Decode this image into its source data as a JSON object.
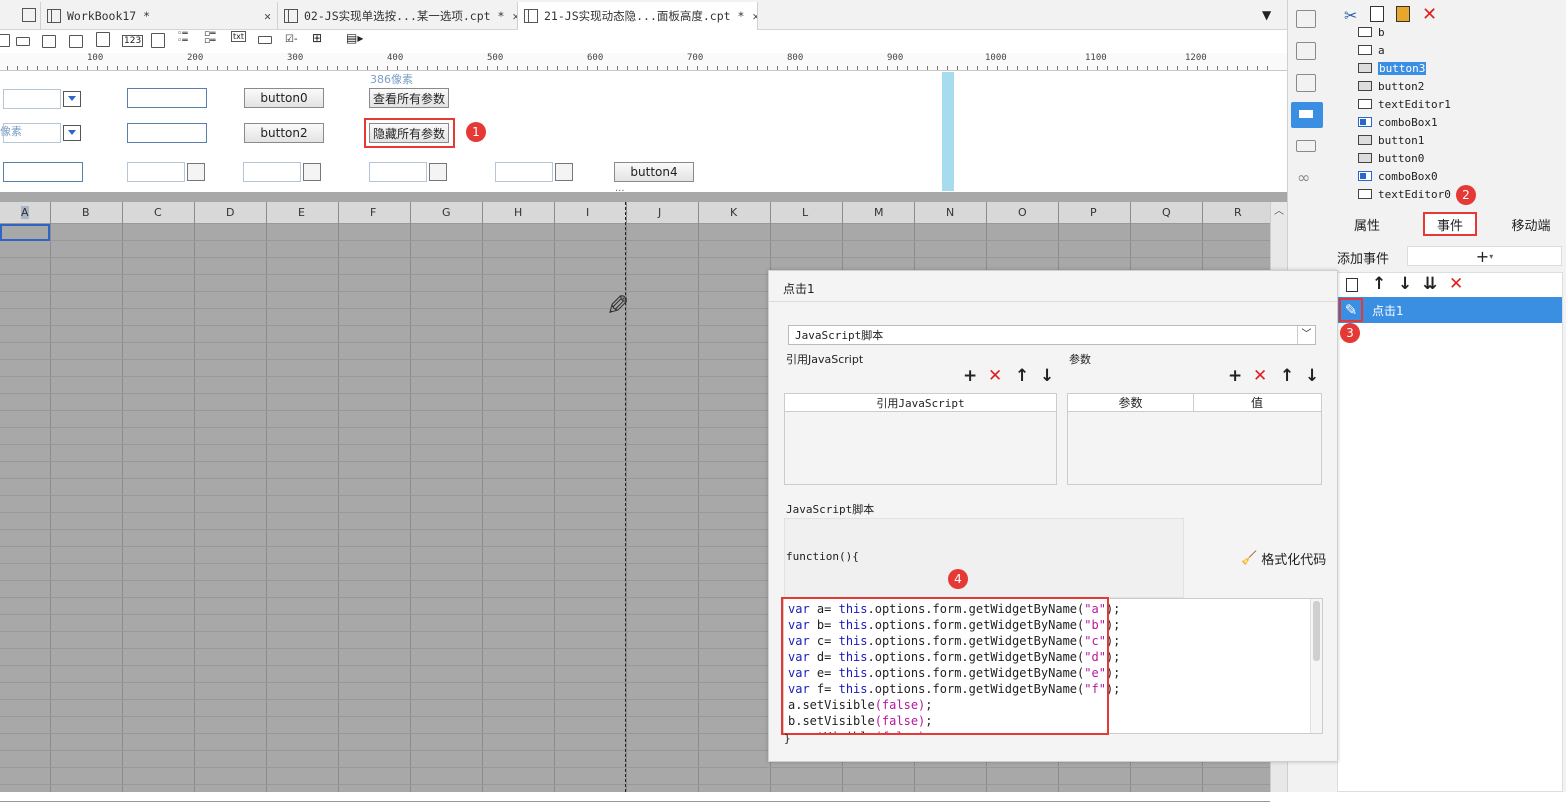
{
  "tabs": [
    {
      "label": "WorkBook17 *"
    },
    {
      "label": "02-JS实现单选按...某一选项.cpt *"
    },
    {
      "label": "21-JS实现动态隐...面板高度.cpt *"
    }
  ],
  "ruler": [
    "100",
    "200",
    "300",
    "400",
    "500",
    "600",
    "700",
    "800",
    "900",
    "1000",
    "1100",
    "1200"
  ],
  "form": {
    "dimension_hint": "386像素",
    "left_hint": "像素",
    "button0": "button0",
    "button2": "button2",
    "button4": "button4",
    "show_all": "查看所有参数",
    "hide_all": "隐藏所有参数"
  },
  "columns": [
    "A",
    "B",
    "C",
    "D",
    "E",
    "F",
    "G",
    "H",
    "I",
    "J",
    "K",
    "L",
    "M",
    "N",
    "O",
    "P",
    "Q",
    "R"
  ],
  "tree": {
    "items": [
      "b",
      "a",
      "button3",
      "button2",
      "textEditor1",
      "comboBox1",
      "button1",
      "button0",
      "comboBox0",
      "textEditor0"
    ],
    "selected_index": 2
  },
  "panel_tabs": {
    "properties": "属性",
    "events": "事件",
    "mobile": "移动端"
  },
  "add_event_label": "添加事件",
  "event_item": "点击1",
  "dialog": {
    "title": "点击1",
    "type_select": "JavaScript脚本",
    "ref_js_label": "引用JavaScript",
    "params_label": "参数",
    "ref_js_col": "引用JavaScript",
    "param_col": "参数",
    "value_col": "值",
    "script_label": "JavaScript脚本",
    "function_header": "function(){",
    "format_code": "格式化代码",
    "closing_brace": "}",
    "code_lines": [
      {
        "kw": "var",
        "pre": " a= ",
        "this": "this",
        "mid": ".options.form.getWidgetByName(",
        "arg": "\"a\"",
        "post": ");"
      },
      {
        "kw": "var",
        "pre": " b= ",
        "this": "this",
        "mid": ".options.form.getWidgetByName(",
        "arg": "\"b\"",
        "post": ");"
      },
      {
        "kw": "var",
        "pre": " c= ",
        "this": "this",
        "mid": ".options.form.getWidgetByName(",
        "arg": "\"c\"",
        "post": ");"
      },
      {
        "kw": "var",
        "pre": " d= ",
        "this": "this",
        "mid": ".options.form.getWidgetByName(",
        "arg": "\"d\"",
        "post": ");"
      },
      {
        "kw": "var",
        "pre": " e= ",
        "this": "this",
        "mid": ".options.form.getWidgetByName(",
        "arg": "\"e\"",
        "post": ");"
      },
      {
        "kw": "var",
        "pre": " f= ",
        "this": "this",
        "mid": ".options.form.getWidgetByName(",
        "arg": "\"f\"",
        "post": ");"
      }
    ],
    "code_tail": [
      "a.setVisible(false);",
      "b.setVisible(false);"
    ],
    "code_tail_partial": "c.setVisible(false);"
  },
  "badges": [
    "1",
    "2",
    "3",
    "4"
  ],
  "colors": {
    "accent": "#3b8fe3",
    "annotation": "#e53935",
    "keyword": "#1a1ab8",
    "string": "#b5179e"
  }
}
